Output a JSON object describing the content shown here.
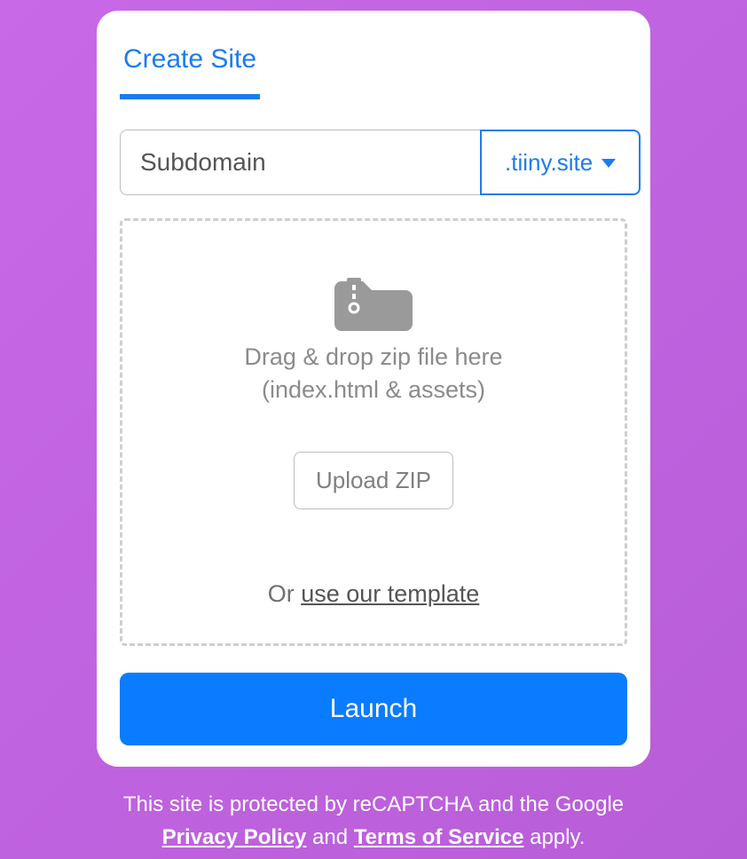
{
  "tab": {
    "create_site": "Create Site"
  },
  "domain": {
    "subdomain_placeholder": "Subdomain",
    "suffix": ".tiiny.site"
  },
  "dropzone": {
    "line1": "Drag & drop zip file here",
    "line2": "(index.html & assets)",
    "upload_button": "Upload ZIP",
    "or_prefix": "Or ",
    "template_link": "use our template"
  },
  "launch_button": "Launch",
  "footer": {
    "line1": "This site is protected by reCAPTCHA and the Google",
    "privacy_link": "Privacy Policy",
    "middle": " and ",
    "terms_link": "Terms of Service",
    "suffix": " apply."
  }
}
